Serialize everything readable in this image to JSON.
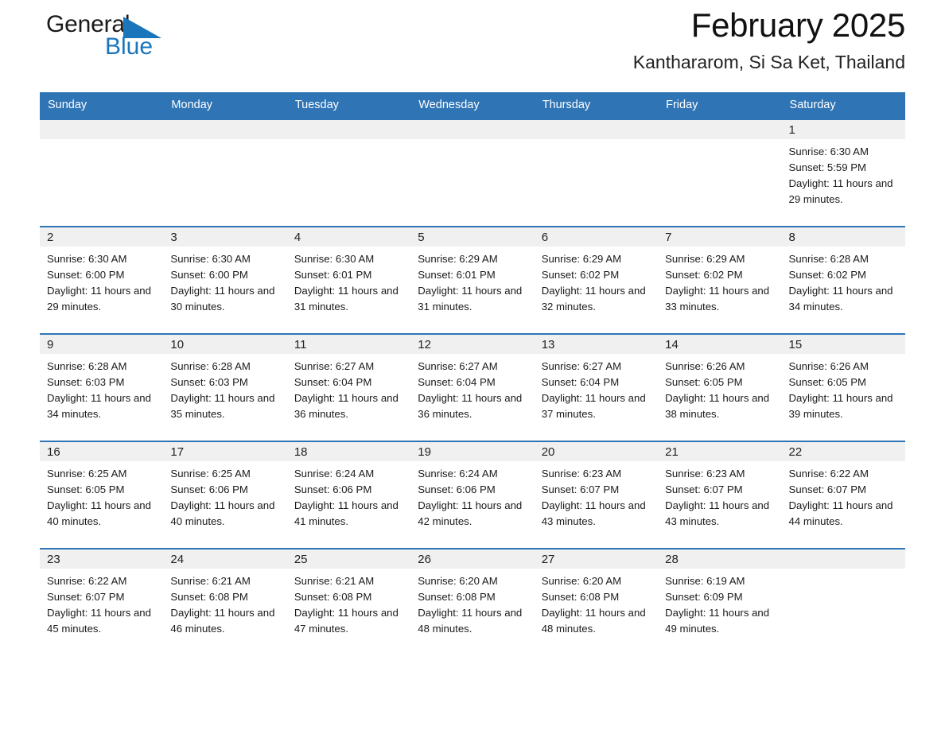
{
  "brand": {
    "name_part1": "General",
    "name_part2": "Blue",
    "triangle_icon": "triangle-icon",
    "accent_color": "#1b75bb"
  },
  "header": {
    "month_title": "February 2025",
    "location": "Kanthararom, Si Sa Ket, Thailand"
  },
  "calendar": {
    "header_color": "#2f74b5",
    "daynum_band_color": "#f0f0f0",
    "weekday_headers": [
      "Sunday",
      "Monday",
      "Tuesday",
      "Wednesday",
      "Thursday",
      "Friday",
      "Saturday"
    ],
    "weeks": [
      [
        {
          "day": "",
          "empty": true
        },
        {
          "day": "",
          "empty": true
        },
        {
          "day": "",
          "empty": true
        },
        {
          "day": "",
          "empty": true
        },
        {
          "day": "",
          "empty": true
        },
        {
          "day": "",
          "empty": true
        },
        {
          "day": "1",
          "sunrise": "Sunrise: 6:30 AM",
          "sunset": "Sunset: 5:59 PM",
          "daylight": "Daylight: 11 hours and 29 minutes."
        }
      ],
      [
        {
          "day": "2",
          "sunrise": "Sunrise: 6:30 AM",
          "sunset": "Sunset: 6:00 PM",
          "daylight": "Daylight: 11 hours and 29 minutes."
        },
        {
          "day": "3",
          "sunrise": "Sunrise: 6:30 AM",
          "sunset": "Sunset: 6:00 PM",
          "daylight": "Daylight: 11 hours and 30 minutes."
        },
        {
          "day": "4",
          "sunrise": "Sunrise: 6:30 AM",
          "sunset": "Sunset: 6:01 PM",
          "daylight": "Daylight: 11 hours and 31 minutes."
        },
        {
          "day": "5",
          "sunrise": "Sunrise: 6:29 AM",
          "sunset": "Sunset: 6:01 PM",
          "daylight": "Daylight: 11 hours and 31 minutes."
        },
        {
          "day": "6",
          "sunrise": "Sunrise: 6:29 AM",
          "sunset": "Sunset: 6:02 PM",
          "daylight": "Daylight: 11 hours and 32 minutes."
        },
        {
          "day": "7",
          "sunrise": "Sunrise: 6:29 AM",
          "sunset": "Sunset: 6:02 PM",
          "daylight": "Daylight: 11 hours and 33 minutes."
        },
        {
          "day": "8",
          "sunrise": "Sunrise: 6:28 AM",
          "sunset": "Sunset: 6:02 PM",
          "daylight": "Daylight: 11 hours and 34 minutes."
        }
      ],
      [
        {
          "day": "9",
          "sunrise": "Sunrise: 6:28 AM",
          "sunset": "Sunset: 6:03 PM",
          "daylight": "Daylight: 11 hours and 34 minutes."
        },
        {
          "day": "10",
          "sunrise": "Sunrise: 6:28 AM",
          "sunset": "Sunset: 6:03 PM",
          "daylight": "Daylight: 11 hours and 35 minutes."
        },
        {
          "day": "11",
          "sunrise": "Sunrise: 6:27 AM",
          "sunset": "Sunset: 6:04 PM",
          "daylight": "Daylight: 11 hours and 36 minutes."
        },
        {
          "day": "12",
          "sunrise": "Sunrise: 6:27 AM",
          "sunset": "Sunset: 6:04 PM",
          "daylight": "Daylight: 11 hours and 36 minutes."
        },
        {
          "day": "13",
          "sunrise": "Sunrise: 6:27 AM",
          "sunset": "Sunset: 6:04 PM",
          "daylight": "Daylight: 11 hours and 37 minutes."
        },
        {
          "day": "14",
          "sunrise": "Sunrise: 6:26 AM",
          "sunset": "Sunset: 6:05 PM",
          "daylight": "Daylight: 11 hours and 38 minutes."
        },
        {
          "day": "15",
          "sunrise": "Sunrise: 6:26 AM",
          "sunset": "Sunset: 6:05 PM",
          "daylight": "Daylight: 11 hours and 39 minutes."
        }
      ],
      [
        {
          "day": "16",
          "sunrise": "Sunrise: 6:25 AM",
          "sunset": "Sunset: 6:05 PM",
          "daylight": "Daylight: 11 hours and 40 minutes."
        },
        {
          "day": "17",
          "sunrise": "Sunrise: 6:25 AM",
          "sunset": "Sunset: 6:06 PM",
          "daylight": "Daylight: 11 hours and 40 minutes."
        },
        {
          "day": "18",
          "sunrise": "Sunrise: 6:24 AM",
          "sunset": "Sunset: 6:06 PM",
          "daylight": "Daylight: 11 hours and 41 minutes."
        },
        {
          "day": "19",
          "sunrise": "Sunrise: 6:24 AM",
          "sunset": "Sunset: 6:06 PM",
          "daylight": "Daylight: 11 hours and 42 minutes."
        },
        {
          "day": "20",
          "sunrise": "Sunrise: 6:23 AM",
          "sunset": "Sunset: 6:07 PM",
          "daylight": "Daylight: 11 hours and 43 minutes."
        },
        {
          "day": "21",
          "sunrise": "Sunrise: 6:23 AM",
          "sunset": "Sunset: 6:07 PM",
          "daylight": "Daylight: 11 hours and 43 minutes."
        },
        {
          "day": "22",
          "sunrise": "Sunrise: 6:22 AM",
          "sunset": "Sunset: 6:07 PM",
          "daylight": "Daylight: 11 hours and 44 minutes."
        }
      ],
      [
        {
          "day": "23",
          "sunrise": "Sunrise: 6:22 AM",
          "sunset": "Sunset: 6:07 PM",
          "daylight": "Daylight: 11 hours and 45 minutes."
        },
        {
          "day": "24",
          "sunrise": "Sunrise: 6:21 AM",
          "sunset": "Sunset: 6:08 PM",
          "daylight": "Daylight: 11 hours and 46 minutes."
        },
        {
          "day": "25",
          "sunrise": "Sunrise: 6:21 AM",
          "sunset": "Sunset: 6:08 PM",
          "daylight": "Daylight: 11 hours and 47 minutes."
        },
        {
          "day": "26",
          "sunrise": "Sunrise: 6:20 AM",
          "sunset": "Sunset: 6:08 PM",
          "daylight": "Daylight: 11 hours and 48 minutes."
        },
        {
          "day": "27",
          "sunrise": "Sunrise: 6:20 AM",
          "sunset": "Sunset: 6:08 PM",
          "daylight": "Daylight: 11 hours and 48 minutes."
        },
        {
          "day": "28",
          "sunrise": "Sunrise: 6:19 AM",
          "sunset": "Sunset: 6:09 PM",
          "daylight": "Daylight: 11 hours and 49 minutes."
        },
        {
          "day": "",
          "empty": true
        }
      ]
    ]
  }
}
